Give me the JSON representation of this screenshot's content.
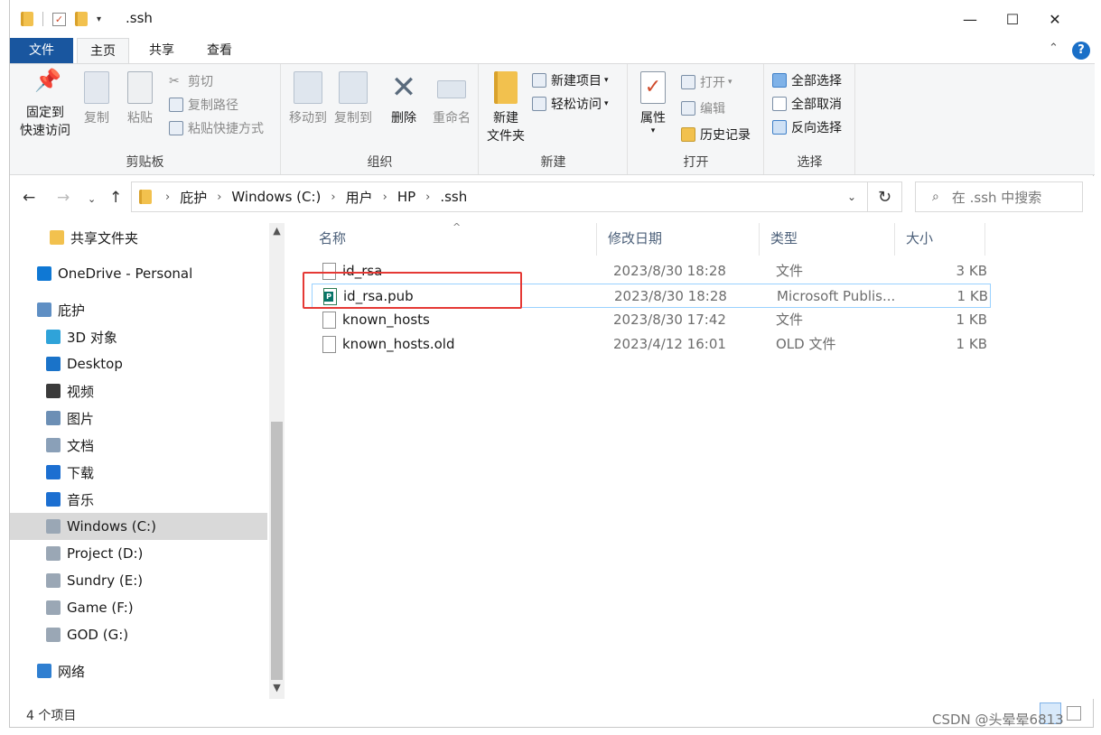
{
  "window": {
    "title": ".ssh",
    "min": "—",
    "max": "☐",
    "close": "✕"
  },
  "ribbon_tabs": [
    "文件",
    "主页",
    "共享",
    "查看"
  ],
  "help": "?",
  "ribbon": {
    "clipboard": {
      "pin_line1": "固定到",
      "pin_line2": "快速访问",
      "copy": "复制",
      "paste": "粘贴",
      "cut": "剪切",
      "copy_path": "复制路径",
      "paste_shortcut": "粘贴快捷方式",
      "label": "剪贴板"
    },
    "organize": {
      "move_to": "移动到",
      "copy_to": "复制到",
      "delete": "删除",
      "rename": "重命名",
      "label": "组织"
    },
    "new": {
      "new_folder_line1": "新建",
      "new_folder_line2": "文件夹",
      "new_item": "新建项目",
      "easy_access": "轻松访问",
      "label": "新建"
    },
    "open": {
      "properties": "属性",
      "open": "打开",
      "edit": "编辑",
      "history": "历史记录",
      "label": "打开"
    },
    "select": {
      "select_all": "全部选择",
      "select_none": "全部取消",
      "invert": "反向选择",
      "label": "选择"
    }
  },
  "address": {
    "crumbs": [
      "庇护",
      "Windows (C:)",
      "用户",
      "HP",
      ".ssh"
    ],
    "search_placeholder": "在 .ssh 中搜索"
  },
  "nav_pane": [
    {
      "label": "共享文件夹",
      "icon": "shared-folder-icon",
      "color": "#f2c14e"
    },
    {
      "label": "OneDrive - Personal",
      "icon": "onedrive-icon",
      "color": "#0f78d4"
    },
    {
      "label": "庇护",
      "icon": "this-pc-icon",
      "color": "#5f8fc4"
    },
    {
      "label": "3D 对象",
      "icon": "3d-objects-icon",
      "color": "#2fa3d9"
    },
    {
      "label": "Desktop",
      "icon": "desktop-icon",
      "color": "#1a73c9"
    },
    {
      "label": "视频",
      "icon": "videos-icon",
      "color": "#3b3b3b"
    },
    {
      "label": "图片",
      "icon": "pictures-icon",
      "color": "#6c8fb5"
    },
    {
      "label": "文档",
      "icon": "documents-icon",
      "color": "#8aa0b8"
    },
    {
      "label": "下载",
      "icon": "downloads-icon",
      "color": "#1c6fd1"
    },
    {
      "label": "音乐",
      "icon": "music-icon",
      "color": "#1c6fd1"
    },
    {
      "label": "Windows (C:)",
      "icon": "drive-c-icon",
      "color": "#9aa7b5"
    },
    {
      "label": "Project (D:)",
      "icon": "drive-icon",
      "color": "#9aa7b5"
    },
    {
      "label": "Sundry (E:)",
      "icon": "drive-icon",
      "color": "#9aa7b5"
    },
    {
      "label": "Game (F:)",
      "icon": "drive-icon",
      "color": "#9aa7b5"
    },
    {
      "label": "GOD (G:)",
      "icon": "drive-icon",
      "color": "#9aa7b5"
    },
    {
      "label": "网络",
      "icon": "network-icon",
      "color": "#2f7fd1"
    }
  ],
  "columns": [
    "名称",
    "修改日期",
    "类型",
    "大小"
  ],
  "files": [
    {
      "name": "id_rsa",
      "date": "2023/8/30 18:28",
      "type": "文件",
      "size": "3 KB"
    },
    {
      "name": "id_rsa.pub",
      "date": "2023/8/30 18:28",
      "type": "Microsoft Publis...",
      "size": "1 KB"
    },
    {
      "name": "known_hosts",
      "date": "2023/8/30 17:42",
      "type": "文件",
      "size": "1 KB"
    },
    {
      "name": "known_hosts.old",
      "date": "2023/4/12 16:01",
      "type": "OLD 文件",
      "size": "1 KB"
    }
  ],
  "status": {
    "count": "4 个项目"
  },
  "watermark": "CSDN @头晕晕6813"
}
